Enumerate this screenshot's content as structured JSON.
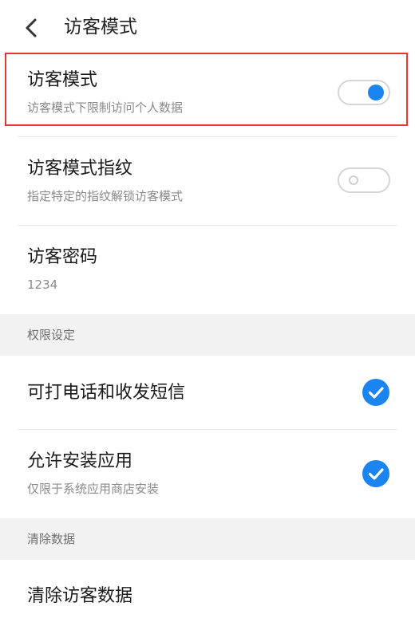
{
  "header": {
    "title": "访客模式"
  },
  "rows": {
    "guest_mode": {
      "title": "访客模式",
      "subtitle": "访客模式下限制访问个人数据",
      "enabled": true
    },
    "guest_fingerprint": {
      "title": "访客模式指纹",
      "subtitle": "指定特定的指纹解锁访客模式",
      "enabled": false
    },
    "guest_password": {
      "title": "访客密码",
      "value": "1234"
    }
  },
  "sections": {
    "permissions": {
      "label": "权限设定"
    },
    "clear": {
      "label": "清除数据"
    }
  },
  "permissions": {
    "calls_sms": {
      "title": "可打电话和收发短信",
      "checked": true
    },
    "install_apps": {
      "title": "允许安装应用",
      "subtitle": "仅限于系统应用商店安装",
      "checked": true
    }
  },
  "clear": {
    "clear_guest_data": {
      "title": "清除访客数据"
    }
  },
  "colors": {
    "accent": "#1a84f0",
    "highlight_border": "#e53935",
    "section_bg": "#f2f2f2"
  },
  "icons": {
    "back": "chevron-left-icon",
    "check": "checkmark-icon"
  }
}
